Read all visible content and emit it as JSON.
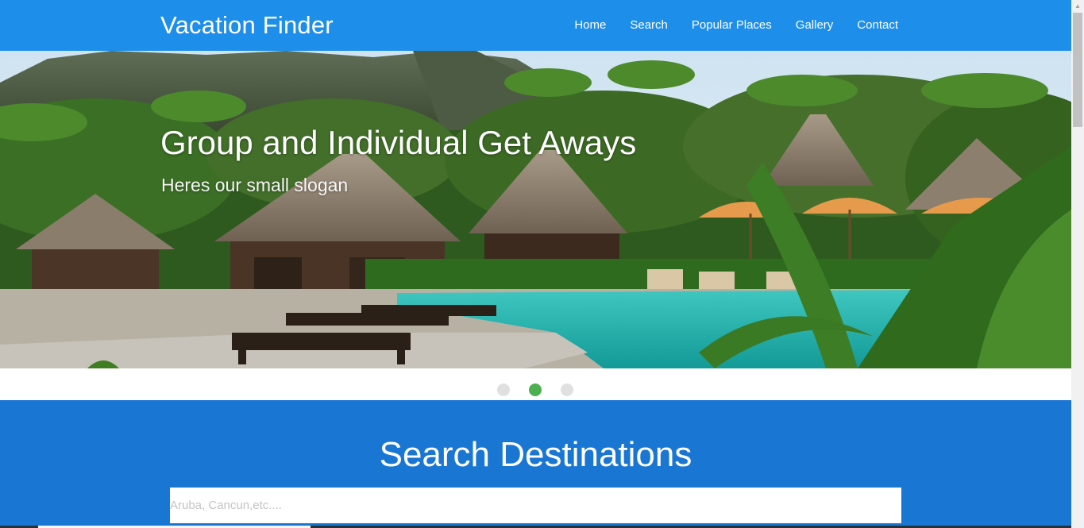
{
  "header": {
    "brand": "Vacation Finder",
    "nav": [
      {
        "label": "Home"
      },
      {
        "label": "Search"
      },
      {
        "label": "Popular Places"
      },
      {
        "label": "Gallery"
      },
      {
        "label": "Contact"
      }
    ]
  },
  "hero": {
    "title": "Group and Individual Get Aways",
    "subtitle": "Heres our small slogan",
    "image_description": "tropical resort pool surrounded by thatched-roof villas and palm trees"
  },
  "carousel": {
    "slide_count": 3,
    "active_index": 1
  },
  "search": {
    "title": "Search Destinations",
    "placeholder": "Aruba, Cancun,etc...."
  },
  "colors": {
    "header_bg": "#1e8eeb",
    "search_bg": "#1976d2",
    "dot_active": "#4caf50",
    "dot_inactive": "#e0e0e0"
  }
}
